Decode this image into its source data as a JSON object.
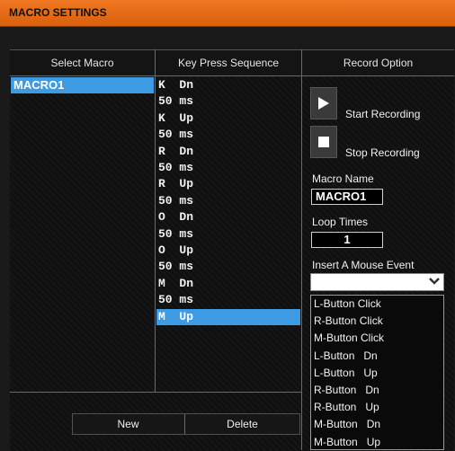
{
  "window": {
    "title": "MACRO SETTINGS"
  },
  "columns": {
    "select_macro": "Select Macro",
    "key_sequence": "Key Press Sequence",
    "record_option": "Record Option"
  },
  "macros": [
    "MACRO1"
  ],
  "sequence": [
    {
      "text": "K  Dn",
      "selected": false
    },
    {
      "text": "50 ms",
      "selected": false
    },
    {
      "text": "K  Up",
      "selected": false
    },
    {
      "text": "50 ms",
      "selected": false
    },
    {
      "text": "R  Dn",
      "selected": false
    },
    {
      "text": "50 ms",
      "selected": false
    },
    {
      "text": "R  Up",
      "selected": false
    },
    {
      "text": "50 ms",
      "selected": false
    },
    {
      "text": "O  Dn",
      "selected": false
    },
    {
      "text": "50 ms",
      "selected": false
    },
    {
      "text": "O  Up",
      "selected": false
    },
    {
      "text": "50 ms",
      "selected": false
    },
    {
      "text": "M  Dn",
      "selected": false
    },
    {
      "text": "50 ms",
      "selected": false
    },
    {
      "text": "M  Up",
      "selected": true
    }
  ],
  "record": {
    "start_label": "Start Recording",
    "stop_label": "Stop Recording",
    "start_icon": "play-icon",
    "stop_icon": "stop-icon",
    "macro_name_label": "Macro Name",
    "macro_name_value": "MACRO1",
    "loop_times_label": "Loop Times",
    "loop_times_value": "1",
    "mouse_event_label": "Insert A Mouse Event",
    "mouse_event_value": ""
  },
  "mouse_events": [
    "L-Button Click",
    "R-Button Click",
    "M-Button Click",
    "L-Button   Dn",
    "L-Button   Up",
    "R-Button   Dn",
    "R-Button   Up",
    "M-Button   Dn",
    "M-Button   Up"
  ],
  "buttons": {
    "new": "New",
    "delete": "Delete"
  },
  "colors": {
    "accent": "#E8701A",
    "selection": "#3D9BE4",
    "background": "#101010"
  }
}
